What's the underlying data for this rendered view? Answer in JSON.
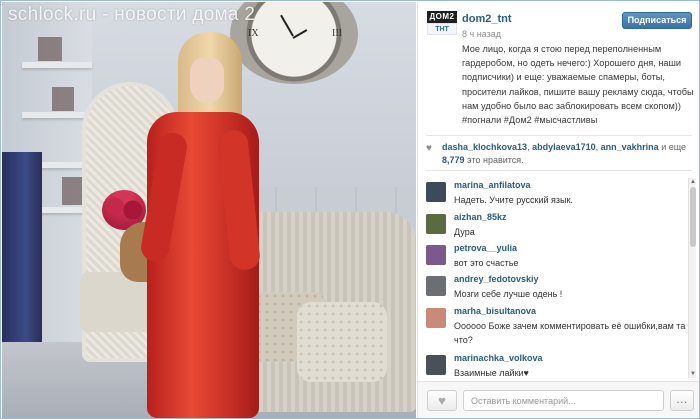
{
  "watermark": "schlock.ru - новости дома 2",
  "header": {
    "logo_top": "ДОМ2",
    "logo_bottom": "ТНТ",
    "username": "dom2_tnt",
    "follow_label": "Подписаться",
    "time": "8 ч назад"
  },
  "caption": "Мое лицо, когда я стою перед переполненным гардеробом, но одеть нечего:) Хорошего дня, наши подписчики) и еще: уважаемые спамеры, боты, просители лайков, пишите вашу рекламу сюда, чтобы нам удобно было вас заблокировать всем скопом)) #погнали #Дом2 #мысчастливы",
  "likes": {
    "users": [
      "dasha_klochkova13",
      "abdylaeva1710",
      "ann_vakhrina"
    ],
    "suffix": "и еще",
    "count": "8,779",
    "count_text": "это нравится."
  },
  "comments": [
    {
      "user": "marina_anfilatova",
      "text": "Надеть. Учите русский язык.",
      "avatar_color": "#3d4a5a"
    },
    {
      "user": "aizhan_85kz",
      "text": "Дура",
      "avatar_color": "#5a6b3f"
    },
    {
      "user": "petrova__yulia",
      "text": "вот это счастье",
      "avatar_color": "#7a5a8c"
    },
    {
      "user": "andrey_fedotovskiy",
      "text": "Мозги себе лучше одень !",
      "avatar_color": "#6b6e73"
    },
    {
      "user": "marha_bisultanova",
      "text": "Оооооо Боже зачем комментировать её ошибки,вам та что?",
      "avatar_color": "#c98a7a"
    },
    {
      "user": "marinachka_volkova",
      "text": "Взаимные лайки♥",
      "avatar_color": "#4a4f58"
    }
  ],
  "footer": {
    "comment_placeholder": "Оставить комментарий...",
    "more_label": "..."
  }
}
